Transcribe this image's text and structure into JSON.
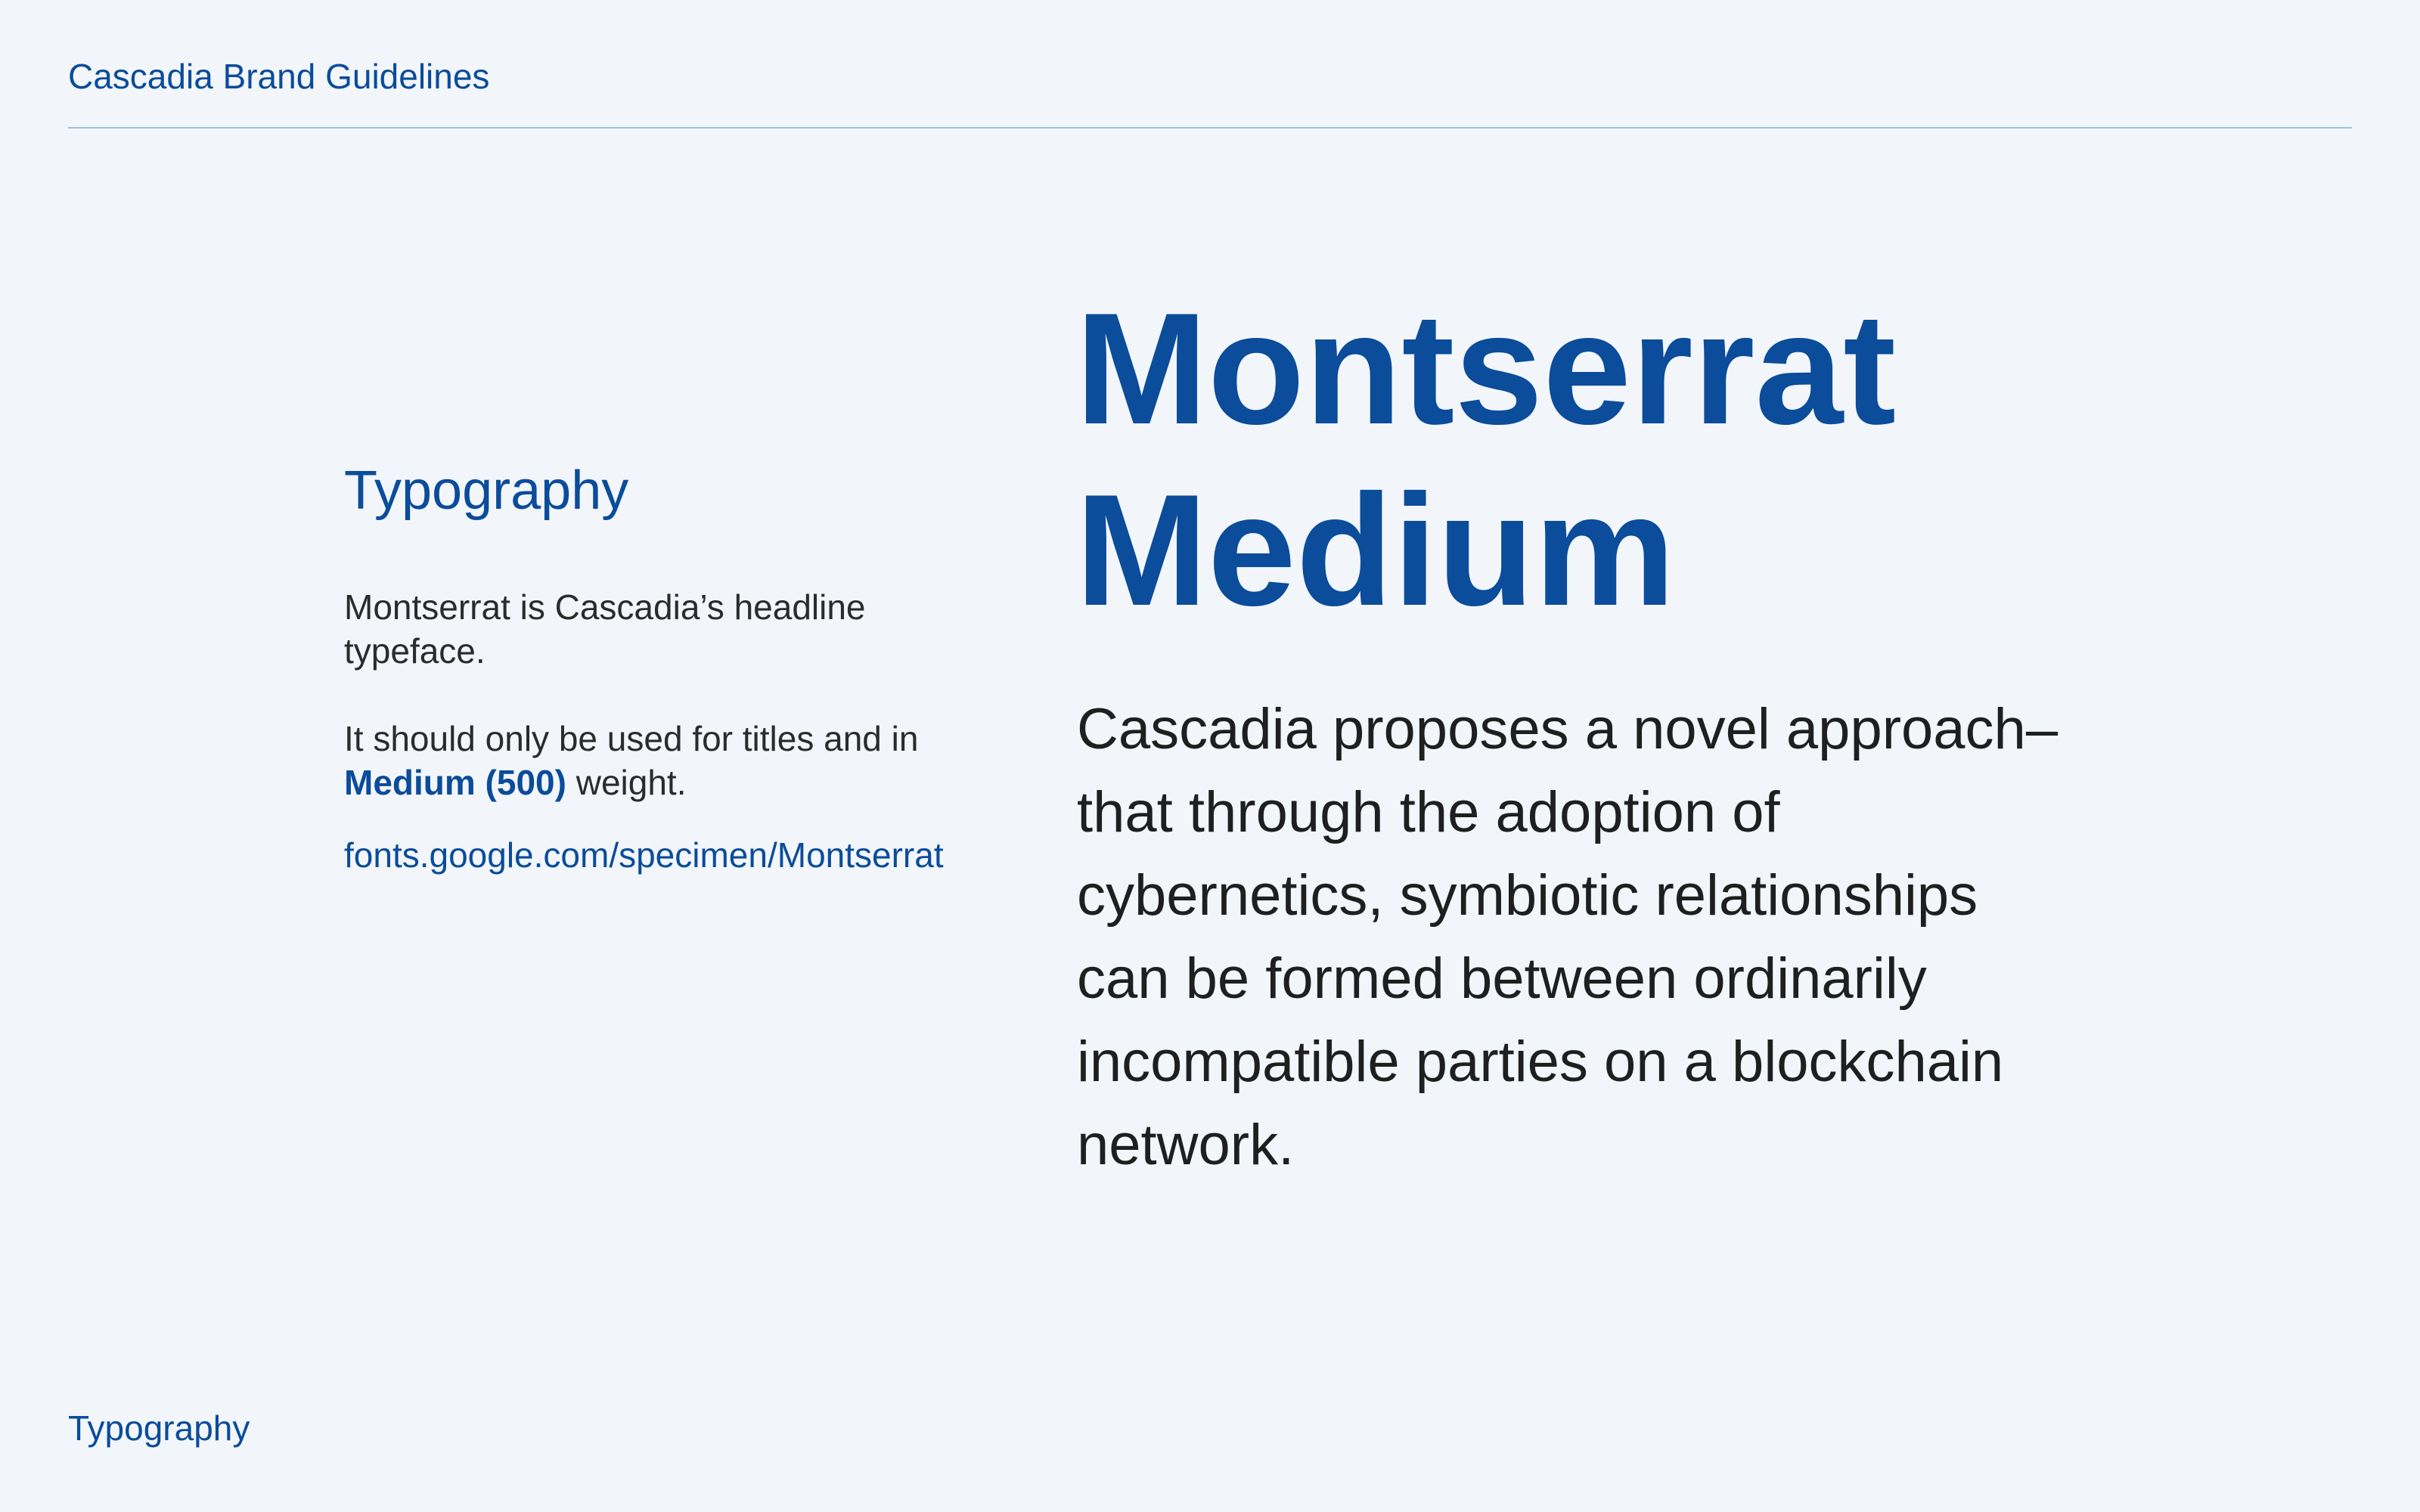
{
  "header": {
    "title": "Cascadia Brand Guidelines"
  },
  "section": {
    "heading": "Typography",
    "description_1": "Montserrat is Cascadia’s headline typeface.",
    "description_2_before": "It should only be used for titles and in ",
    "description_2_highlight": "Medium (500)",
    "description_2_after": " weight.",
    "link_text": "fonts.google.com/specimen/Montserrat"
  },
  "specimen": {
    "title_line_1": "Montserrat",
    "title_line_2": "Medium",
    "sample_text": "Cascadia proposes a novel approach–that through the adoption of cybernetics, symbiotic relationships can be formed between ordinarily incompatible parties on a blockchain network."
  },
  "footer": {
    "label": "Typography"
  },
  "colors": {
    "background": "#f2f6fb",
    "brand_blue": "#0b4c9b",
    "body_text": "#1f1f1f",
    "rule": "#9fbfdf"
  }
}
